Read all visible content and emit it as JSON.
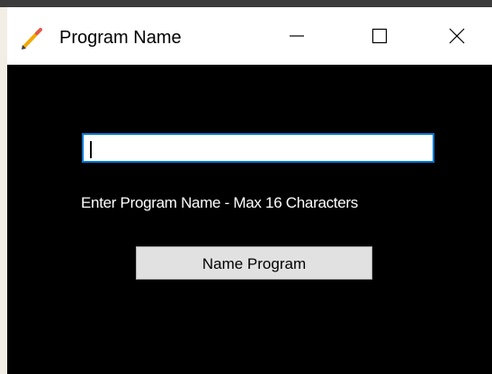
{
  "window": {
    "title": "Program Name",
    "icon": "pencil-icon",
    "controls": {
      "minimize_icon": "minimize-icon",
      "maximize_icon": "maximize-icon",
      "close_icon": "close-icon"
    }
  },
  "form": {
    "input_value": "",
    "hint": "Enter Program Name - Max 16 Characters",
    "button_label": "Name Program"
  },
  "colors": {
    "window_background": "#000000",
    "titlebar_background": "#ffffff",
    "input_focus_border": "#0078d7",
    "button_background": "#e1e1e1"
  }
}
